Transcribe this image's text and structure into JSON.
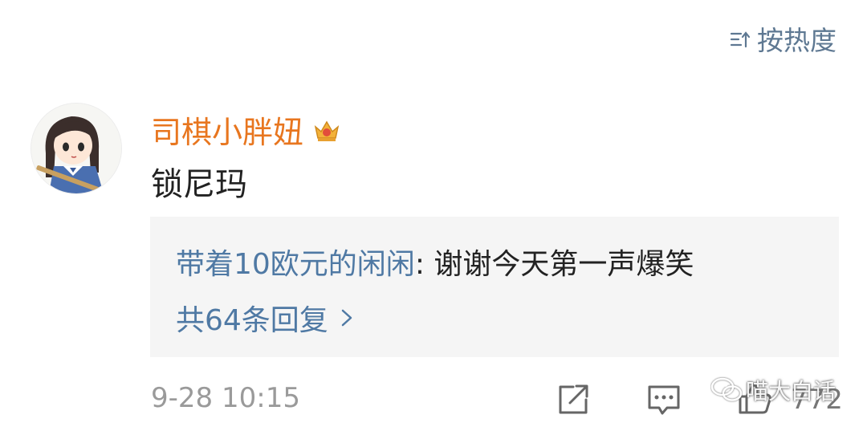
{
  "sort": {
    "label": "按热度",
    "icon": "sort-icon"
  },
  "comment": {
    "username": "司棋小胖妞",
    "username_color": "#e8761f",
    "badge_icon": "crown-badge-icon",
    "text": "锁尼玛",
    "time": "9-28 10:15",
    "like_count": "772"
  },
  "reply": {
    "author": "带着10欧元的闲闲",
    "separator": ":",
    "text": "谢谢今天第一声爆笑",
    "count_label": "共64条回复",
    "author_color": "#4f79a4"
  },
  "actions": {
    "share_icon": "share-icon",
    "comment_icon": "comment-icon",
    "like_icon": "thumbs-up-icon"
  },
  "watermark": {
    "text": "喵大白话",
    "icon": "wechat-icon"
  }
}
